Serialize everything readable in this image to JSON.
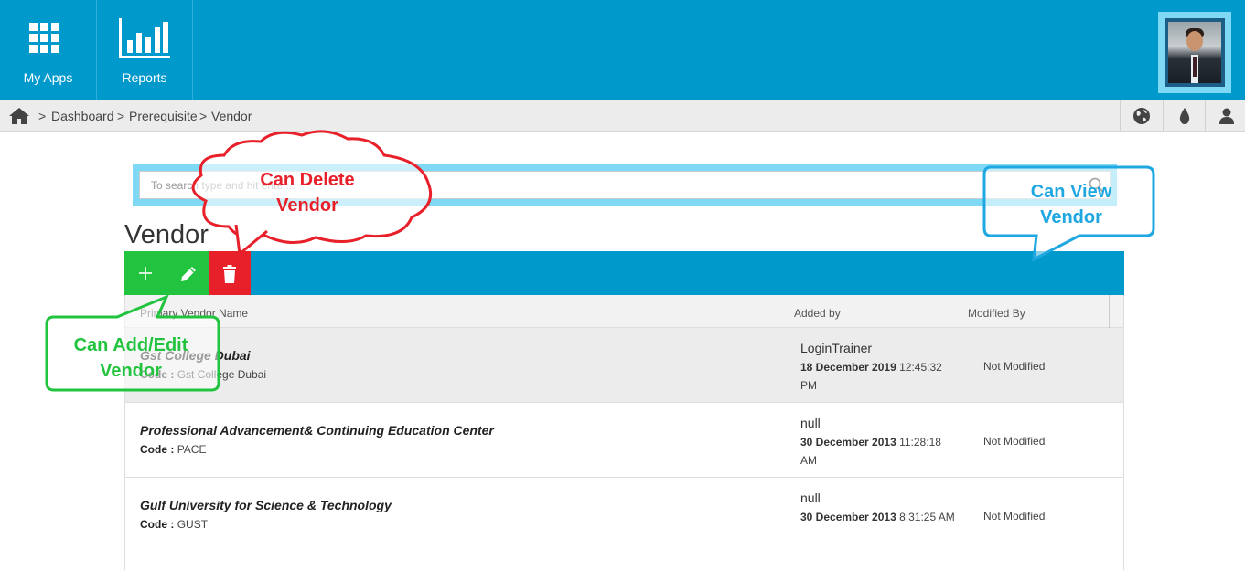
{
  "nav": {
    "items": [
      {
        "label": "My Apps",
        "icon": "grid-icon"
      },
      {
        "label": "Reports",
        "icon": "bar-chart-icon"
      }
    ]
  },
  "breadcrumb": {
    "items": [
      "Dashboard",
      "Prerequisite",
      "Vendor"
    ],
    "separator": ">"
  },
  "search": {
    "placeholder": "To search type and hit enter..."
  },
  "page": {
    "title": "Vendor"
  },
  "table": {
    "columns": [
      "Primary Vendor Name",
      "Added by",
      "Modified By"
    ],
    "code_label": "Code :",
    "rows": [
      {
        "name": "Gst College Dubai",
        "code": "Gst College Dubai",
        "added_by": "LoginTrainer",
        "added_date": "18 December 2019",
        "added_time": "12:45:32 PM",
        "modified_by": "Not Modified"
      },
      {
        "name": "Professional Advancement& Continuing Education Center",
        "code": "PACE",
        "added_by": "null",
        "added_date": "30 December 2013",
        "added_time": "11:28:18 AM",
        "modified_by": "Not Modified"
      },
      {
        "name": "Gulf University for Science & Technology",
        "code": "GUST",
        "added_by": "null",
        "added_date": "30 December 2013",
        "added_time": "8:31:25 AM",
        "modified_by": "Not Modified"
      }
    ]
  },
  "annotations": {
    "delete": {
      "line1": "Can Delete",
      "line2": "Vendor",
      "color": "#e8202a"
    },
    "view": {
      "line1": "Can View",
      "line2": "Vendor",
      "color": "#1ea7e1"
    },
    "add_edit": {
      "line1": "Can Add/Edit",
      "line2": "Vendor",
      "color": "#22c43f"
    }
  },
  "colors": {
    "brand": "#0099cc",
    "highlight": "#7fd9f5",
    "add_edit_button": "#22c43f",
    "delete_button": "#e8202a"
  }
}
